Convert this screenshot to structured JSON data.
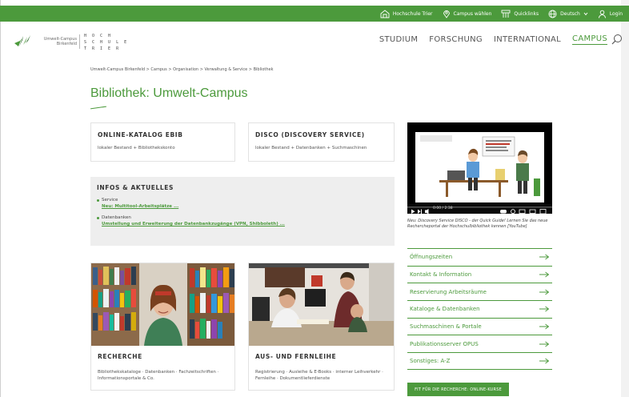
{
  "topbar": {
    "items": [
      {
        "label": "Hochschule Trier",
        "icon": "building-icon"
      },
      {
        "label": "Campus wählen",
        "icon": "map-pin-icon"
      },
      {
        "label": "Quicklinks",
        "icon": "quicklinks-icon"
      },
      {
        "label": "Deutsch",
        "icon": "globe-icon"
      },
      {
        "label": "Login",
        "icon": "user-icon"
      }
    ],
    "color": "#4c9a3c"
  },
  "logo": {
    "campus_line1": "Umwelt-Campus",
    "campus_line2": "Birkenfeld",
    "hochschule_lines": "H O C H\nS C H U L E\nT R I E R"
  },
  "mainnav": {
    "items": [
      "STUDIUM",
      "FORSCHUNG",
      "INTERNATIONAL",
      "CAMPUS"
    ],
    "active": "CAMPUS"
  },
  "breadcrumb": "Umwelt-Campus Birkenfeld > Campus > Organisation > Verwaltung & Service > Bibliothek",
  "page_title": "Bibliothek: Umwelt-Campus",
  "cards": {
    "opac": {
      "title": "ONLINE-KATALOG EBIB",
      "sub": "lokaler Bestand + Bibliothekskonto"
    },
    "disco": {
      "title": "DISCO (DISCOVERY SERVICE)",
      "sub": "lokaler Bestand + Datenbanken + Suchmaschinen"
    }
  },
  "infos": {
    "title": "INFOS & AKTUELLES",
    "entries": [
      {
        "category": "Service",
        "link": "Neu: Multitool-Arbeitsplätze ..."
      },
      {
        "category": "Datenbanken",
        "link": "Umstellung und Erweiterung der Datenbankzugänge (VPN, Shibboleth) ..."
      }
    ]
  },
  "image_cards": {
    "recherche": {
      "title": "RECHERCHE",
      "sub": "Bibliothekskataloge · Datenbanken · Fachzeitschriften · Informationsportale & Co."
    },
    "fernleihe": {
      "title": "AUS- UND FERNLEIHE",
      "sub": "Registrierung · Ausleihe & E-Books · interner Leihverkehr · Fernleihe · Dokumentlieferdienste"
    }
  },
  "video": {
    "caption": "Neu: Discovery Service DISCO - der Quick Guide! Lernen Sie das neue Rechercheportal der Hochschulbibliothek kennen [YouTube]",
    "time": "0:00 / 2:38"
  },
  "links": [
    "Öffnungszeiten",
    "Kontakt & Information",
    "Reservierung Arbeitsräume",
    "Kataloge & Datenbanken",
    "Suchmaschinen & Portale",
    "Publikationsserver OPUS",
    "Sonstiges: A-Z"
  ],
  "cta": "FIT FÜR DIE RECHERCHE: ONLINE-KURSE"
}
